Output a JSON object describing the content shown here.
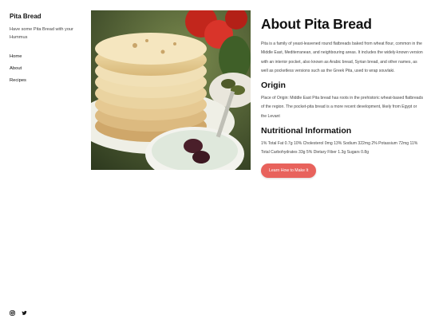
{
  "site": {
    "title": "Pita Bread",
    "tagline": "Have some Pita Bread with your Hummus"
  },
  "nav": [
    {
      "label": "Home"
    },
    {
      "label": "About"
    },
    {
      "label": "Recipes"
    }
  ],
  "social": {
    "instagram_icon": "instagram-icon",
    "twitter_icon": "twitter-icon"
  },
  "hero": {
    "image_desc": "plate-of-pita-with-yogurt-dip-icon"
  },
  "main": {
    "title": "About Pita Bread",
    "intro": "Pita is a family of yeast-leavened round flatbreads baked from wheat flour, common in the Middle East, Mediterranean, and neighbouring areas. It includes the widely-known version with an interior pocket, also known as Arabic bread, Syrian bread, and other names, as well as pocketless versions such as the Greek Pita, used to wrap souvlaki.",
    "origin_heading": "Origin",
    "origin_text": "Place of Origin: Middle East Pita bread has roots in the prehistoric wheat-based flatbreads of the region. The pocket-pita bread is a more recent development, likely from Egypt or the Levant",
    "nutrition_heading": "Nutritional Information",
    "nutrition_text": "1% Total Fat 0.7g 10% Cholesterol 0mg 13% Sodium 322mg 2% Potassium 72mg 11% Total Carbohydrates 33g 5% Dietary Fiber 1.3g Sugars 0.8g",
    "cta_label": "Learn How to Make It"
  },
  "colors": {
    "accent": "#e8625c"
  }
}
